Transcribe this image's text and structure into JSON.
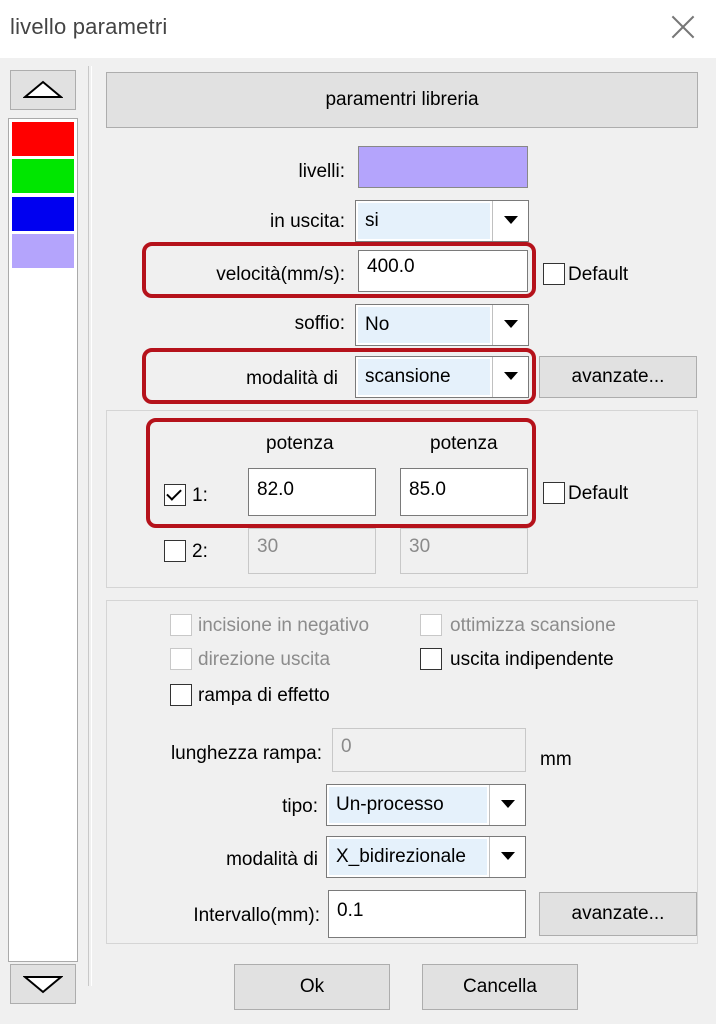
{
  "window": {
    "title": "livello parametri"
  },
  "sidebar": {
    "swatches": [
      {
        "color": "#ff0000"
      },
      {
        "color": "#00e600"
      },
      {
        "color": "#0000f0"
      },
      {
        "color": "#b4a4fc"
      }
    ]
  },
  "library_button": "paramentri libreria",
  "layers": {
    "label": "livelli:",
    "color": "#b4a4fc"
  },
  "output": {
    "label": "in uscita:",
    "value": "si"
  },
  "speed": {
    "label": "velocità(mm/s):",
    "value": "400.0",
    "default_label": "Default",
    "default_checked": false
  },
  "blow": {
    "label": "soffio:",
    "value": "No"
  },
  "scan_mode": {
    "label": "modalità di",
    "value": "scansione",
    "advanced_label": "avanzate..."
  },
  "power": {
    "header_1": "potenza",
    "header_2": "potenza",
    "row1": {
      "label": "1:",
      "checked": true,
      "min": "82.0",
      "max": "85.0"
    },
    "row2": {
      "label": "2:",
      "checked": false,
      "min": "30",
      "max": "30"
    },
    "default_label": "Default",
    "default_checked": false
  },
  "options": {
    "negative_engraving": "incisione in negativo",
    "optimize_scan": "ottimizza scansione",
    "output_direction": "direzione uscita",
    "independent_output": "uscita indipendente",
    "ramp_effect": "rampa di effetto"
  },
  "ramp": {
    "label": "lunghezza rampa:",
    "value": "0",
    "unit": "mm"
  },
  "type": {
    "label": "tipo:",
    "value": "Un-processo"
  },
  "mode2": {
    "label": "modalità di",
    "value": "X_bidirezionale"
  },
  "interval": {
    "label": "Intervallo(mm):",
    "value": "0.1",
    "advanced_label": "avanzate..."
  },
  "footer": {
    "ok_label": "Ok",
    "cancel_label": "Cancella"
  },
  "accent": {
    "highlight": "#b5121b"
  }
}
